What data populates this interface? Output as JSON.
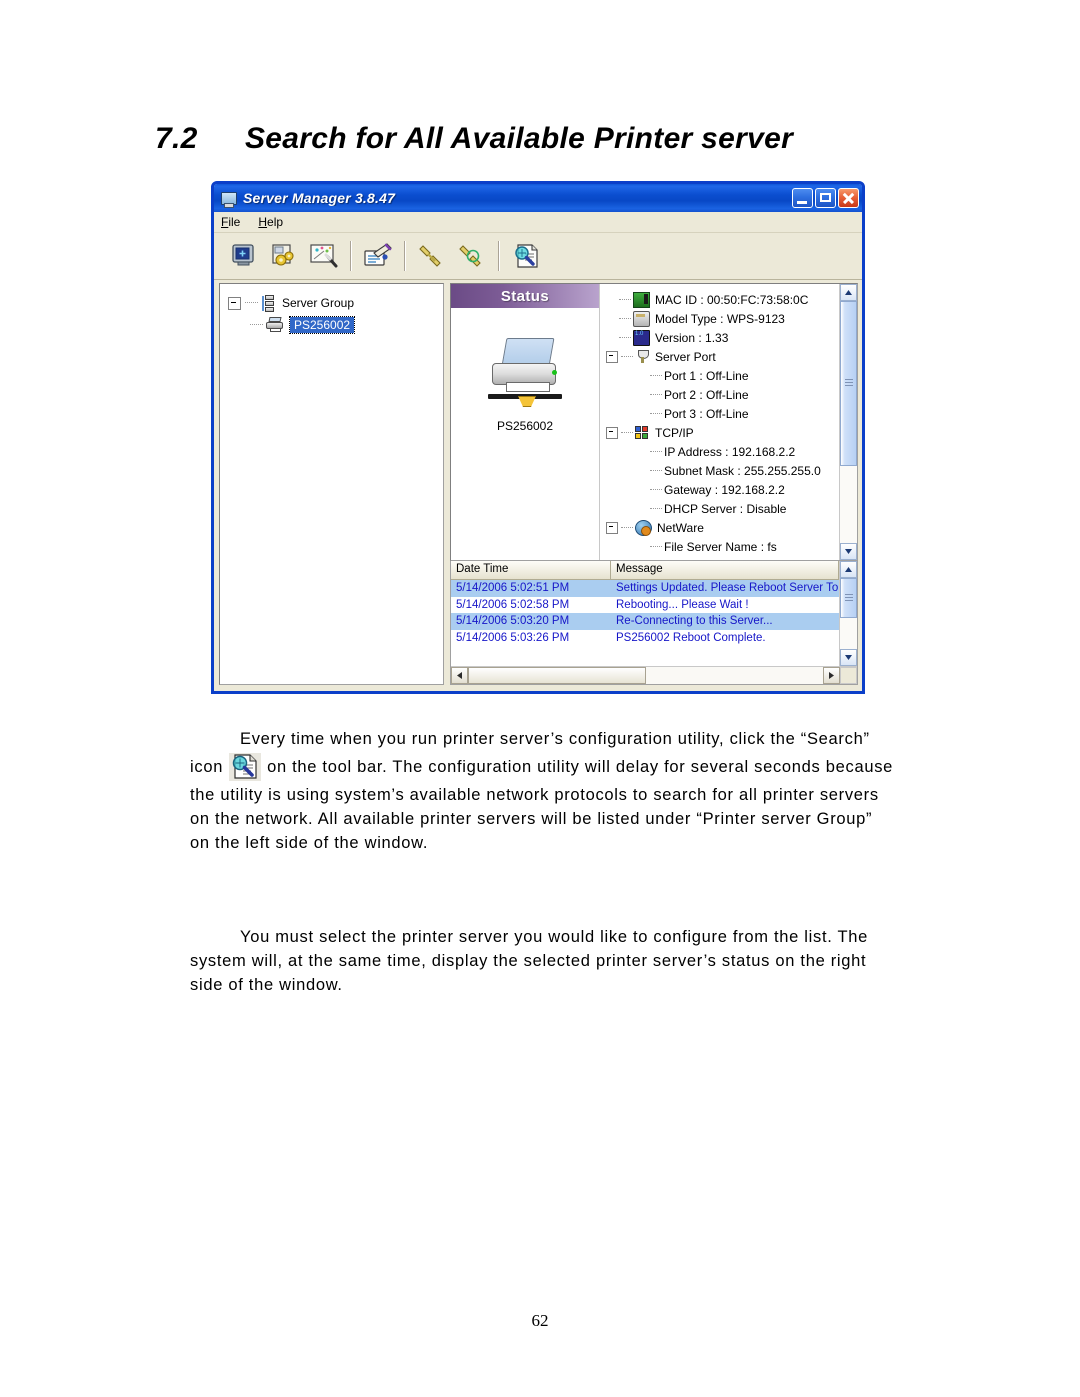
{
  "heading": {
    "number": "7.2",
    "title": "Search for All Available Printer server"
  },
  "window": {
    "title": "Server Manager 3.8.47",
    "app_icon": "monitor-icon",
    "buttons": {
      "minimize": "minimize-button",
      "maximize": "maximize-button",
      "close": "close-button"
    },
    "menu": [
      {
        "label": "File",
        "accel": "F"
      },
      {
        "label": "Help",
        "accel": "H"
      }
    ],
    "toolbar": [
      {
        "name": "general-config-icon"
      },
      {
        "name": "server-settings-icon"
      },
      {
        "name": "wizard-icon"
      },
      {
        "name": "report-icon"
      },
      {
        "name": "connect-icon"
      },
      {
        "name": "disconnect-icon"
      },
      {
        "name": "search-icon"
      }
    ]
  },
  "tree": {
    "root": {
      "label": "Server Group",
      "icon": "server-group-icon",
      "expanded": true
    },
    "children": [
      {
        "label": "PS256002",
        "icon": "printer-icon",
        "selected": true
      }
    ]
  },
  "status": {
    "banner": "Status",
    "device_icon": "printer-large-icon",
    "device_name": "PS256002"
  },
  "details": [
    {
      "level": 0,
      "icon": "mac-icon",
      "label": "MAC ID : 00:50:FC:73:58:0C",
      "expander": "none"
    },
    {
      "level": 0,
      "icon": "model-icon",
      "label": "Model Type : WPS-9123",
      "expander": "none"
    },
    {
      "level": 0,
      "icon": "version-icon",
      "label": "Version : 1.33",
      "expander": "none"
    },
    {
      "level": 0,
      "icon": "port-icon",
      "label": "Server Port",
      "expander": "expanded"
    },
    {
      "level": 1,
      "icon": null,
      "label": "Port 1 : Off-Line",
      "expander": "none"
    },
    {
      "level": 1,
      "icon": null,
      "label": "Port 2 : Off-Line",
      "expander": "none"
    },
    {
      "level": 1,
      "icon": null,
      "label": "Port 3 : Off-Line",
      "expander": "none"
    },
    {
      "level": 0,
      "icon": "tcpip-icon",
      "label": "TCP/IP",
      "expander": "expanded"
    },
    {
      "level": 1,
      "icon": null,
      "label": "IP Address : 192.168.2.2",
      "expander": "none"
    },
    {
      "level": 1,
      "icon": null,
      "label": "Subnet Mask : 255.255.255.0",
      "expander": "none"
    },
    {
      "level": 1,
      "icon": null,
      "label": "Gateway : 192.168.2.2",
      "expander": "none"
    },
    {
      "level": 1,
      "icon": null,
      "label": "DHCP Server : Disable",
      "expander": "none"
    },
    {
      "level": 0,
      "icon": "netware-icon",
      "label": "NetWare",
      "expander": "expanded"
    },
    {
      "level": 1,
      "icon": null,
      "label": "File Server Name : fs",
      "expander": "none"
    }
  ],
  "log": {
    "columns": [
      "Date Time",
      "Message"
    ],
    "rows": [
      {
        "date": "5/14/2006 5:02:51 PM",
        "message": "Settings Updated. Please Reboot Server To Ta",
        "highlighted": true
      },
      {
        "date": "5/14/2006 5:02:58 PM",
        "message": "Rebooting... Please Wait !",
        "highlighted": false
      },
      {
        "date": "5/14/2006 5:03:20 PM",
        "message": "Re-Connecting to this Server...",
        "highlighted": true
      },
      {
        "date": "5/14/2006 5:03:26 PM",
        "message": "PS256002 Reboot Complete.",
        "highlighted": false
      }
    ]
  },
  "paragraphs": {
    "p1_a": "Every time when you run printer server’s configuration utility, click",
    "p1_b": "the “Search” icon",
    "p1_c": "on the tool bar. The configuration utility will delay for several seconds because the utility is using system’s available network protocols to search for all printer servers on the network. All available printer servers will be listed under “Printer server Group” on the left side of the window.",
    "p2": "You must select the printer server you would like to configure from the list. The system will, at the same time, display the selected printer server’s status on the right side of the window."
  },
  "page_number": "62",
  "colors": {
    "title_bar": "#0b4ed0",
    "window_border": "#0b3fc9",
    "status_banner_start": "#6b4b86",
    "status_banner_end": "#b9a3cd",
    "selection_blue": "#3168c8",
    "log_highlight": "#aacdf0",
    "log_text": "#1616c8",
    "chrome": "#ece9d8"
  }
}
